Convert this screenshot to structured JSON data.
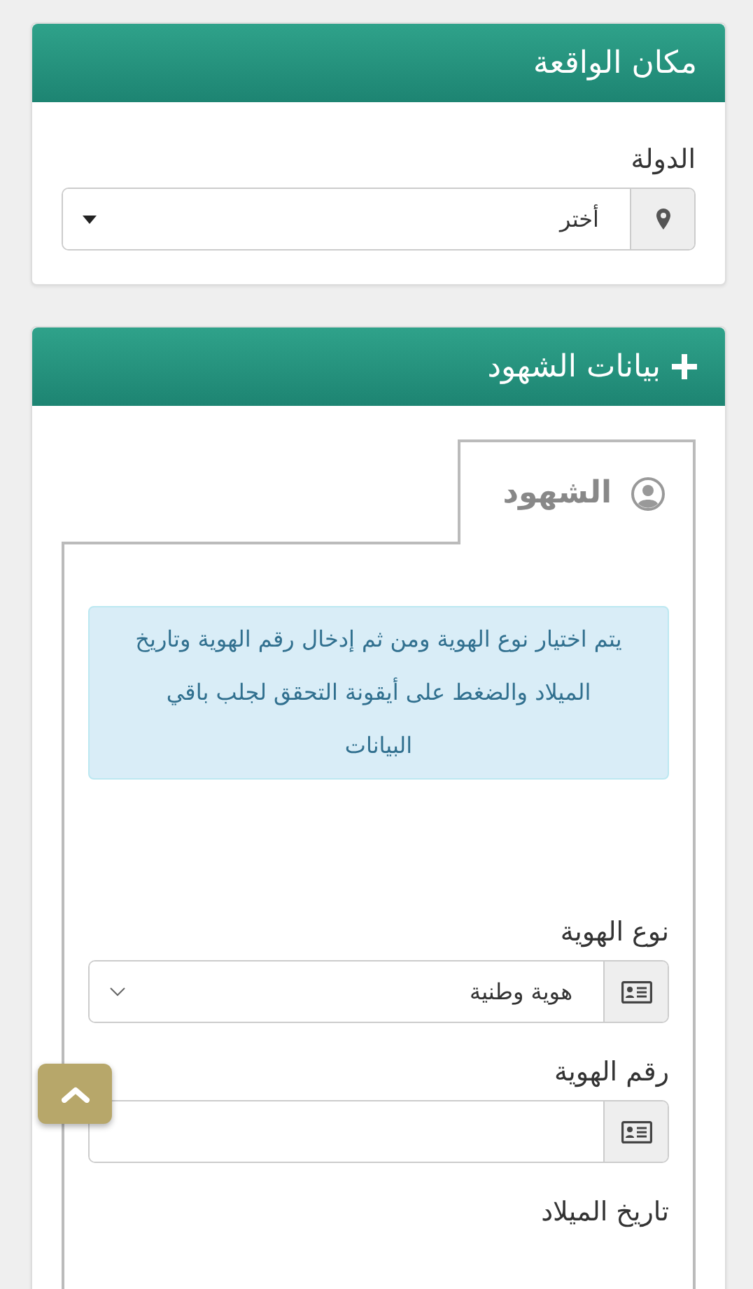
{
  "sections": [
    {
      "title": "مكان الواقعة",
      "fields": [
        {
          "label": "الدولة",
          "kind": "select",
          "value": "أختر"
        }
      ]
    },
    {
      "title": "بيانات الشهود",
      "tab": {
        "label": "الشهود"
      },
      "notice": "يتم اختيار نوع الهوية ومن ثم إدخال رقم الهوية وتاريخ الميلاد والضغط على أيقونة التحقق لجلب باقي البيانات",
      "fields": [
        {
          "label": "نوع الهوية",
          "kind": "select",
          "value": "هوية وطنية"
        },
        {
          "label": "رقم الهوية",
          "kind": "input"
        },
        {
          "label": "تاريخ الميلاد",
          "kind": "label"
        }
      ]
    }
  ]
}
